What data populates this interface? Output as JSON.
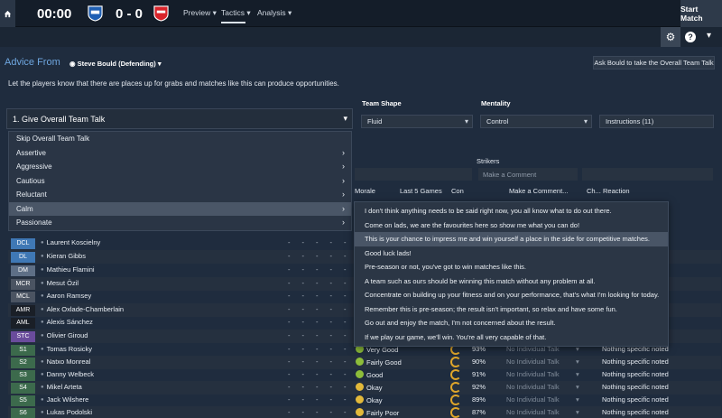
{
  "topbar": {
    "clock": "00:00",
    "score": "0 - 0",
    "nav": [
      "Preview",
      "Tactics",
      "Analysis"
    ],
    "start_match": "Start Match"
  },
  "advice": {
    "label": "Advice From",
    "advisor": "Steve Bould (Defending)",
    "ask_button": "Ask Bould to take the Overall Team Talk",
    "message": "Let the players know that there are places up for grabs and matches like this can produce opportunities."
  },
  "team_shape": {
    "label": "Team Shape",
    "value": "Fluid"
  },
  "mentality": {
    "label": "Mentality",
    "value": "Control"
  },
  "instructions": {
    "value": "Instructions (11)"
  },
  "strikers": {
    "label": "Strikers",
    "placeholder": "Make a Comment"
  },
  "talk": {
    "header": "1. Give Overall Team Talk",
    "items": [
      "Skip Overall Team Talk",
      "Assertive",
      "Aggressive",
      "Cautious",
      "Reluctant",
      "Calm",
      "Passionate"
    ]
  },
  "columns": {
    "morale": "Morale",
    "last5": "Last 5 Games",
    "con": "Con",
    "comment": "Make a Comment...",
    "ch": "Ch...",
    "reaction": "Reaction"
  },
  "players": [
    {
      "pos": "DCL",
      "name": "Laurent Koscielny"
    },
    {
      "pos": "DL",
      "name": "Kieran Gibbs"
    },
    {
      "pos": "DM",
      "name": "Mathieu Flamini"
    },
    {
      "pos": "MCR",
      "name": "Mesut Özil"
    },
    {
      "pos": "MCL",
      "name": "Aaron Ramsey"
    },
    {
      "pos": "AMR",
      "name": "Alex Oxlade-Chamberlain"
    },
    {
      "pos": "AML",
      "name": "Alexis Sánchez"
    },
    {
      "pos": "STC",
      "name": "Olivier Giroud"
    }
  ],
  "subs": [
    {
      "pos": "S1",
      "name": "Tomas Rosicky",
      "morale": "Very Good",
      "cond": "93%",
      "talk": "No Individual Talk",
      "note": "Nothing specific noted"
    },
    {
      "pos": "S2",
      "name": "Natxo Monreal",
      "morale": "Fairly Good",
      "cond": "90%",
      "talk": "No Individual Talk",
      "note": "Nothing specific noted"
    },
    {
      "pos": "S3",
      "name": "Danny Welbeck",
      "morale": "Good",
      "cond": "91%",
      "talk": "No Individual Talk",
      "note": "Nothing specific noted"
    },
    {
      "pos": "S4",
      "name": "Mikel Arteta",
      "morale": "Okay",
      "cond": "92%",
      "talk": "No Individual Talk",
      "note": "Nothing specific noted"
    },
    {
      "pos": "S5",
      "name": "Jack Wilshere",
      "morale": "Okay",
      "cond": "89%",
      "talk": "No Individual Talk",
      "note": "Nothing specific noted"
    },
    {
      "pos": "S6",
      "name": "Lukas Podolski",
      "morale": "Fairly Poor",
      "cond": "87%",
      "talk": "No Individual Talk",
      "note": "Nothing specific noted"
    }
  ],
  "comments": [
    "I don't think anything needs to be said right now, you all know what to do out there.",
    "Come on lads, we are the favourites here so show me what you can do!",
    "This is your chance to impress me and win yourself a place in the side for competitive matches.",
    "Good luck lads!",
    "Pre-season or not, you've got to win matches like this.",
    "A team such as ours should be winning this match without any problem at all.",
    "Concentrate on building up your fitness and on your performance, that's what I'm looking for today.",
    "Remember this is pre-season; the result isn't important, so relax and have some fun.",
    "Go out and enjoy the match, I'm not concerned about the result.",
    "If we play our game, we'll win. You're all very capable of that."
  ],
  "colors": {
    "pos_defence": "#3f78b5",
    "pos_defmid": "#5e6f86",
    "pos_mid": "#4b5462",
    "pos_attack": "#1a1f27",
    "pos_striker": "#6a4c9c",
    "pos_sub": "#3c6a4c"
  }
}
